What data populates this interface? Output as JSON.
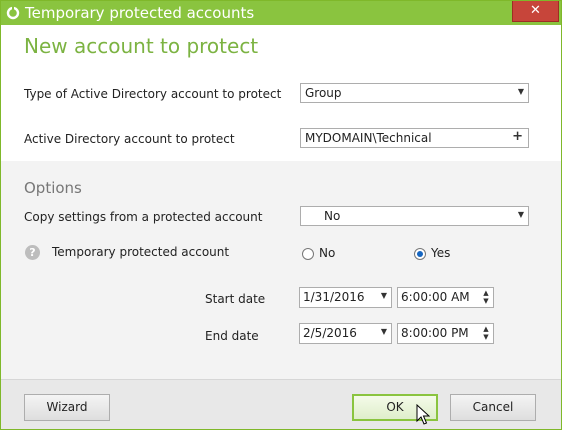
{
  "window": {
    "title": "Temporary protected accounts",
    "close_glyph": "✕"
  },
  "header": {
    "title": "New account to protect"
  },
  "form": {
    "type_label": "Type of Active Directory account to protect",
    "type_value": "Group",
    "account_label": "Active Directory account to protect",
    "account_value": "MYDOMAIN\\Technical"
  },
  "options": {
    "title": "Options",
    "copy_label": "Copy settings from a protected account",
    "copy_value": "No",
    "temporary_label": "Temporary protected account",
    "radio_no": "No",
    "radio_yes": "Yes",
    "selected": "Yes",
    "start_label": "Start date",
    "start_date": "1/31/2016",
    "start_time": "6:00:00 AM",
    "end_label": "End date",
    "end_date": "2/5/2016",
    "end_time": "8:00:00 PM"
  },
  "footer": {
    "wizard_label": "Wizard",
    "ok_label": "OK",
    "cancel_label": "Cancel"
  },
  "icons": {
    "app": "ring-icon",
    "help": "question-icon",
    "dropdown": "chevron-down-icon",
    "add": "plus-icon",
    "spinner": "up-down-arrows-icon",
    "cursor": "mouse-pointer-icon"
  },
  "colors": {
    "accent": "#8ac43f",
    "title_green": "#7cb342",
    "close_red": "#c7453a",
    "radio_selected": "#1565c0"
  }
}
